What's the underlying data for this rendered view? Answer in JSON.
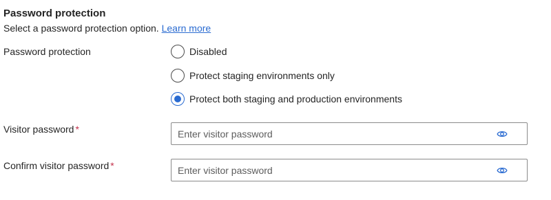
{
  "section": {
    "title": "Password protection",
    "description": "Select a password protection option.",
    "learn_more": "Learn more"
  },
  "password_protection": {
    "label": "Password protection",
    "options": [
      {
        "label": "Disabled",
        "selected": false
      },
      {
        "label": "Protect staging environments only",
        "selected": false
      },
      {
        "label": "Protect both staging and production environments",
        "selected": true
      }
    ]
  },
  "visitor_password": {
    "label": "Visitor password",
    "required_marker": "*",
    "value": "",
    "placeholder": "Enter visitor password",
    "toggle_icon": "eye-icon"
  },
  "confirm_password": {
    "label": "Confirm visitor password",
    "required_marker": "*",
    "value": "",
    "placeholder": "Enter visitor password",
    "toggle_icon": "eye-icon"
  },
  "colors": {
    "accent": "#2a6bd1",
    "required": "#c4314b",
    "border": "#8a8a8a"
  }
}
